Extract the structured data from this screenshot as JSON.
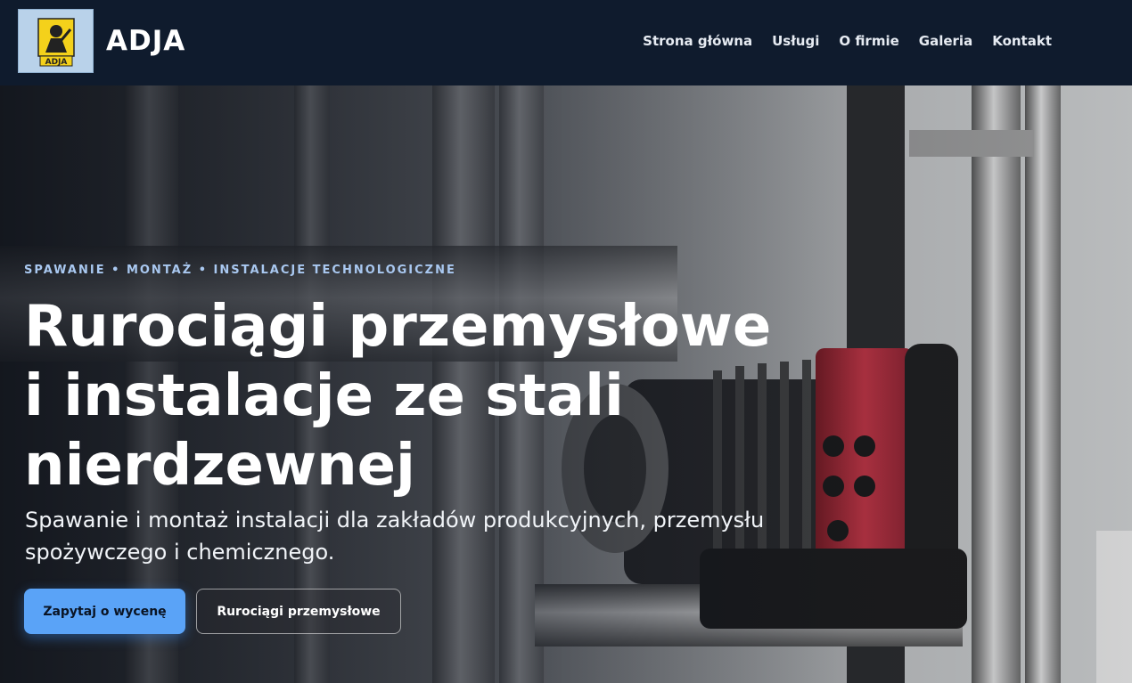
{
  "header": {
    "logo_text": "ADJA",
    "brand_name": "ADJA",
    "nav": [
      {
        "label": "Strona główna"
      },
      {
        "label": "Usługi"
      },
      {
        "label": "O firmie"
      },
      {
        "label": "Galeria"
      },
      {
        "label": "Kontakt"
      }
    ]
  },
  "hero": {
    "eyebrow": "SPAWANIE • MONTAŻ • INSTALACJE TECHNOLOGICZNE",
    "title_lines": [
      "Rurociągi przemysłowe",
      "i instalacje ze stali",
      "nierdzewnej"
    ],
    "subtitle": "Spawanie i montaż instalacji dla zakładów produkcyjnych, przemysłu spożywczego i chemicznego.",
    "primary_button": "Zapytaj o wycenę",
    "secondary_button": "Rurociągi przemysłowe"
  },
  "colors": {
    "header_bg": "#0f1b2d",
    "accent": "#5aa3f7",
    "eyebrow": "#a9c8f0",
    "pump_red": "#b8323f"
  }
}
